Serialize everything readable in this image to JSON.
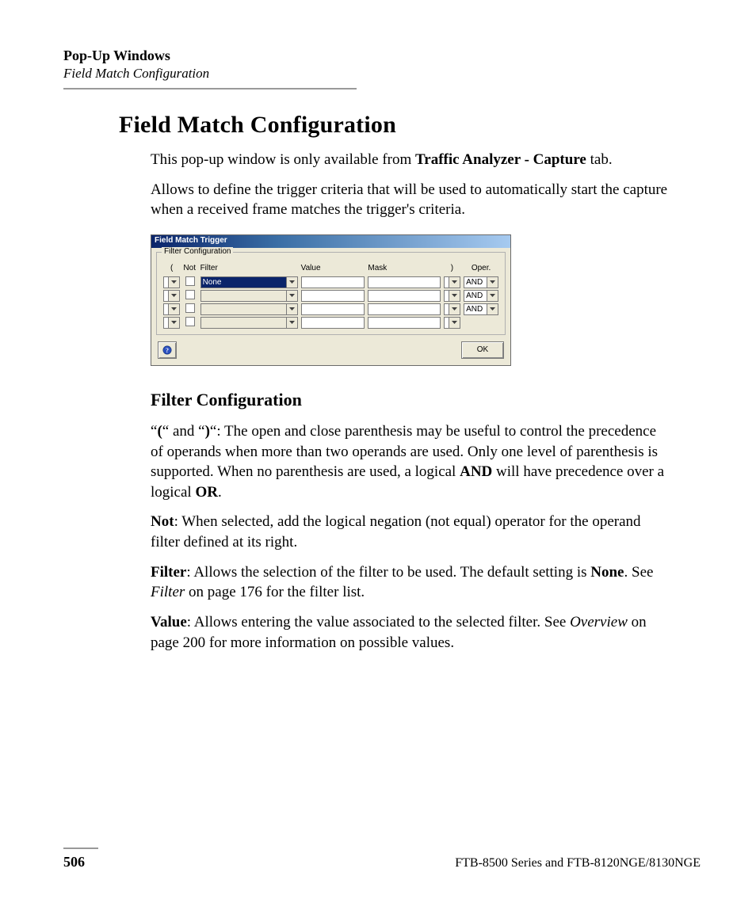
{
  "runningHead": {
    "line1": "Pop-Up Windows",
    "line2": "Field Match Configuration"
  },
  "title": "Field Match Configuration",
  "intro": {
    "p1_a": "This pop-up window is only available from ",
    "p1_b": "Traffic Analyzer - Capture",
    "p1_c": " tab.",
    "p2": "Allows to define the trigger criteria that will be used to automatically start the capture when a received frame matches the trigger's criteria."
  },
  "dialog": {
    "title": "Field Match Trigger",
    "group": "Filter Configuration",
    "cols": {
      "open": "(",
      "not": "Not",
      "filter": "Filter",
      "value": "Value",
      "mask": "Mask",
      "close": ")",
      "oper": "Oper."
    },
    "rows": [
      {
        "open": "",
        "not": false,
        "filter": "None",
        "filterSelected": true,
        "value": "",
        "mask": "",
        "close": "",
        "oper": "AND",
        "hasOper": true
      },
      {
        "open": "",
        "not": false,
        "filter": "",
        "filterSelected": false,
        "value": "",
        "mask": "",
        "close": "",
        "oper": "AND",
        "hasOper": true
      },
      {
        "open": "",
        "not": false,
        "filter": "",
        "filterSelected": false,
        "value": "",
        "mask": "",
        "close": "",
        "oper": "AND",
        "hasOper": true
      },
      {
        "open": "",
        "not": false,
        "filter": "",
        "filterSelected": false,
        "value": "",
        "mask": "",
        "close": "",
        "oper": "",
        "hasOper": false
      }
    ],
    "ok": "OK"
  },
  "subhead": "Filter Configuration",
  "filterConfig": {
    "p1_a": "“",
    "p1_b": "(",
    "p1_c": "“ and “",
    "p1_d": ")",
    "p1_e": "“: The open and close parenthesis may be useful to control the precedence of operands when more than two operands are used. Only one level of parenthesis is supported. When no parenthesis are used, a logical ",
    "p1_f": "AND",
    "p1_g": " will have precedence over a logical ",
    "p1_h": "OR",
    "p1_i": ".",
    "p2_a": "Not",
    "p2_b": ": When selected, add the logical negation (not equal) operator for the operand filter defined at its right.",
    "p3_a": "Filter",
    "p3_b": ": Allows the selection of the filter to be used. The default setting is ",
    "p3_c": "None",
    "p3_d": ". See ",
    "p3_e": "Filter",
    "p3_f": " on page 176 for the filter list.",
    "p4_a": "Value",
    "p4_b": ": Allows entering the value associated to the selected filter. See ",
    "p4_c": "Overview",
    "p4_d": " on page 200 for more information on possible values."
  },
  "footer": {
    "pageNum": "506",
    "product": "FTB-8500 Series and FTB-8120NGE/8130NGE"
  }
}
